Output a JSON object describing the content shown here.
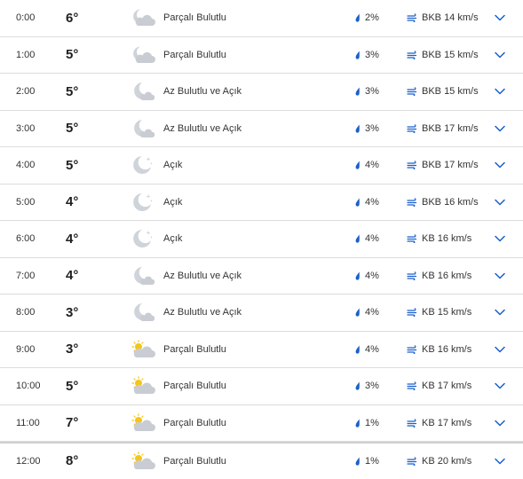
{
  "colors": {
    "accent": "#1a5fcc",
    "cloud": "#c9ccd2",
    "moon": "#cfd3da",
    "sun": "#f5c518",
    "divider": "#dcdcdc"
  },
  "rows": [
    {
      "time": "0:00",
      "temp": "6°",
      "icon": "partly-cloudy-night-icon",
      "condition": "Parçalı Bulutlu",
      "precip": "2%",
      "wind": "BKB 14 km/s"
    },
    {
      "time": "1:00",
      "temp": "5°",
      "icon": "partly-cloudy-night-icon",
      "condition": "Parçalı Bulutlu",
      "precip": "3%",
      "wind": "BKB 15 km/s"
    },
    {
      "time": "2:00",
      "temp": "5°",
      "icon": "mostly-clear-night-icon",
      "condition": "Az Bulutlu ve Açık",
      "precip": "3%",
      "wind": "BKB 15 km/s"
    },
    {
      "time": "3:00",
      "temp": "5°",
      "icon": "mostly-clear-night-icon",
      "condition": "Az Bulutlu ve Açık",
      "precip": "3%",
      "wind": "BKB 17 km/s"
    },
    {
      "time": "4:00",
      "temp": "5°",
      "icon": "clear-night-icon",
      "condition": "Açık",
      "precip": "4%",
      "wind": "BKB 17 km/s"
    },
    {
      "time": "5:00",
      "temp": "4°",
      "icon": "clear-night-icon",
      "condition": "Açık",
      "precip": "4%",
      "wind": "BKB 16 km/s"
    },
    {
      "time": "6:00",
      "temp": "4°",
      "icon": "clear-night-icon",
      "condition": "Açık",
      "precip": "4%",
      "wind": "KB 16 km/s"
    },
    {
      "time": "7:00",
      "temp": "4°",
      "icon": "mostly-clear-night-icon",
      "condition": "Az Bulutlu ve Açık",
      "precip": "4%",
      "wind": "KB 16 km/s"
    },
    {
      "time": "8:00",
      "temp": "3°",
      "icon": "mostly-clear-night-icon",
      "condition": "Az Bulutlu ve Açık",
      "precip": "4%",
      "wind": "KB 15 km/s"
    },
    {
      "time": "9:00",
      "temp": "3°",
      "icon": "partly-cloudy-day-icon",
      "condition": "Parçalı Bulutlu",
      "precip": "4%",
      "wind": "KB 16 km/s"
    },
    {
      "time": "10:00",
      "temp": "5°",
      "icon": "partly-cloudy-day-icon",
      "condition": "Parçalı Bulutlu",
      "precip": "3%",
      "wind": "KB 17 km/s"
    },
    {
      "time": "11:00",
      "temp": "7°",
      "icon": "partly-cloudy-day-icon",
      "condition": "Parçalı Bulutlu",
      "precip": "1%",
      "wind": "KB 17 km/s"
    },
    {
      "time": "12:00",
      "temp": "8°",
      "icon": "partly-cloudy-day-icon",
      "condition": "Parçalı Bulutlu",
      "precip": "1%",
      "wind": "KB 20 km/s"
    }
  ]
}
